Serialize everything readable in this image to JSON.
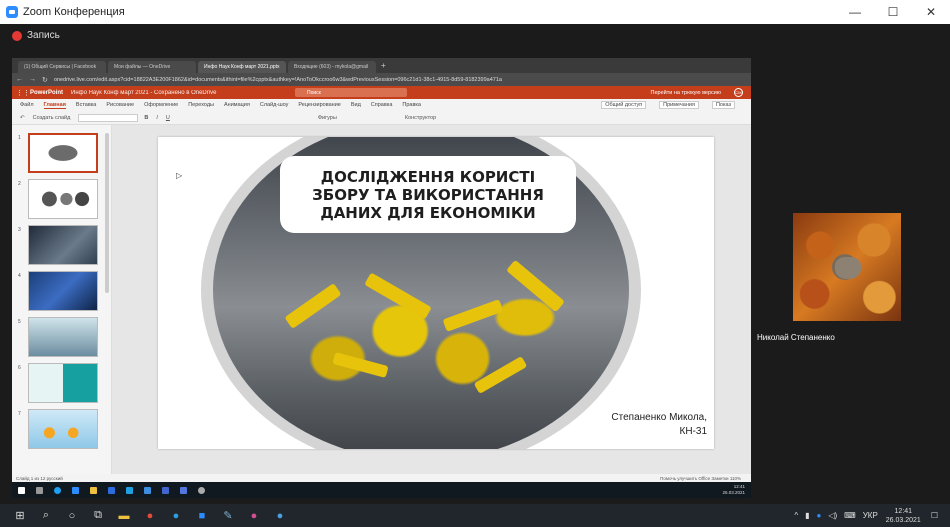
{
  "zoom": {
    "title": "Zoom Конференция",
    "recording_label": "Запись",
    "controls": {
      "minimize": "—",
      "maximize": "☐",
      "close": "✕"
    }
  },
  "browser": {
    "tabs": [
      "(1) Общий Сервисы | Facebook",
      "Мои файлы — OneDrive",
      "Инфо Наук Конф март 2021.pptx",
      "Входящие (603) - mykola@gmail"
    ],
    "new_tab": "+",
    "url": "onedrive.live.com/edit.aspx?cid=18822A3E200F1862&id=documents&ithint=file%2cpptx&authkey=!AnoToOkccroo6w3&wdPreviousSession=096c21d1-38c1-4915-8d59-8182399a471a"
  },
  "ppt": {
    "brand": "PowerPoint",
    "doc_title": "Инфо Наук Конф март 2021 - Сохранено в OneDrive",
    "search_placeholder": "Поиск",
    "classic_label": "Перейти на трюкую версию",
    "avatar": "СМ",
    "menu": [
      "Файл",
      "Главная",
      "Вставка",
      "Рисование",
      "Оформление",
      "Переходы",
      "Анимация",
      "Слайд-шоу",
      "Рецензирование",
      "Вид",
      "Справка",
      "Правка"
    ],
    "menu_active_index": 1,
    "menu_right": [
      "Общий доступ",
      "Примечания",
      "Показ"
    ],
    "ribbon": [
      "Создать слайд",
      "Фигуры",
      "Конструктор"
    ],
    "status_left": "Слайд 1 из 12   русский",
    "status_right": "Помочь улучшить Office   Заметки   110%"
  },
  "slide": {
    "title": "ДОСЛІДЖЕННЯ КОРИСТІ ЗБОРУ ТА ВИКОРИСТАННЯ ДАНИХ ДЛЯ ЕКОНОМІКИ",
    "author_line1": "Степаненко Микола,",
    "author_line2": "КН-31"
  },
  "thumbnails": [
    "1",
    "2",
    "3",
    "4",
    "5",
    "6",
    "7"
  ],
  "inner_clock": {
    "time": "12:41",
    "date": "26.03.2021"
  },
  "participant": {
    "name": "Николай Степаненко"
  },
  "taskbar": {
    "lang": "УКР",
    "time": "12:41",
    "date": "26.03.2021"
  },
  "colors": {
    "ppt_brand": "#c43e1c",
    "zoom_blue": "#2d8cff",
    "rec_red": "#e53935"
  }
}
